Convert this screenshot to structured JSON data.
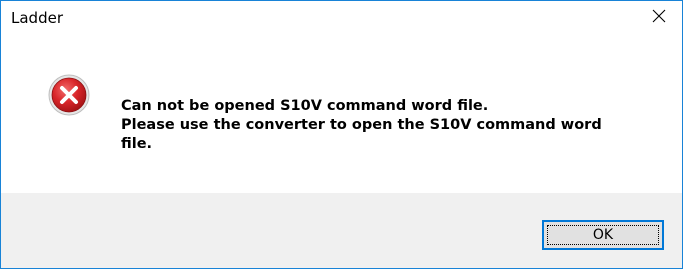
{
  "window": {
    "title": "Ladder",
    "close_glyph": "✕"
  },
  "message": {
    "icon": "error-icon",
    "line1": "Can not be opened S10V command word file.",
    "line2": "Please use the converter to open the S10V command word",
    "line3": "file."
  },
  "buttons": {
    "ok_label": "OK"
  },
  "colors": {
    "window_border": "#1883d7",
    "footer_bg": "#f0f0f0",
    "button_bg": "#e1e1e1",
    "button_border": "#0078d7",
    "error_red": "#d9262a"
  }
}
